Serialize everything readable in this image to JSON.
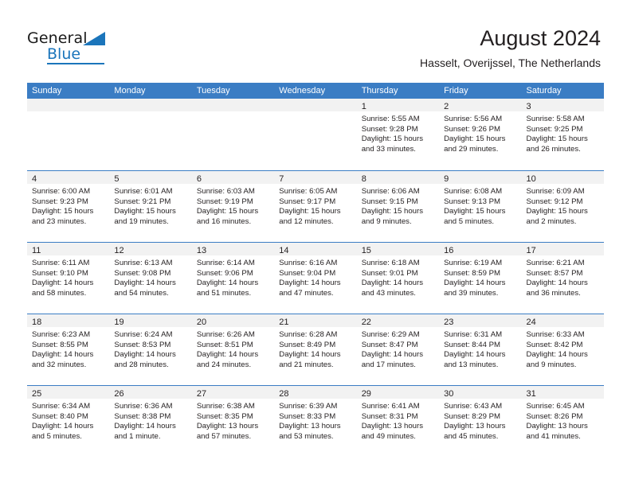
{
  "brand": {
    "name_part1": "General",
    "name_part2": "Blue",
    "accent_color": "#1b75bb"
  },
  "header": {
    "title": "August 2024",
    "subtitle": "Hasselt, Overijssel, The Netherlands"
  },
  "theme": {
    "header_blue": "#3b7dc4",
    "day_band_gray": "#f2f2f2",
    "text_color": "#231f20"
  },
  "weekdays": [
    "Sunday",
    "Monday",
    "Tuesday",
    "Wednesday",
    "Thursday",
    "Friday",
    "Saturday"
  ],
  "weeks": [
    [
      {
        "day": "",
        "lines": []
      },
      {
        "day": "",
        "lines": []
      },
      {
        "day": "",
        "lines": []
      },
      {
        "day": "",
        "lines": []
      },
      {
        "day": "1",
        "lines": [
          "Sunrise: 5:55 AM",
          "Sunset: 9:28 PM",
          "Daylight: 15 hours",
          "and 33 minutes."
        ]
      },
      {
        "day": "2",
        "lines": [
          "Sunrise: 5:56 AM",
          "Sunset: 9:26 PM",
          "Daylight: 15 hours",
          "and 29 minutes."
        ]
      },
      {
        "day": "3",
        "lines": [
          "Sunrise: 5:58 AM",
          "Sunset: 9:25 PM",
          "Daylight: 15 hours",
          "and 26 minutes."
        ]
      }
    ],
    [
      {
        "day": "4",
        "lines": [
          "Sunrise: 6:00 AM",
          "Sunset: 9:23 PM",
          "Daylight: 15 hours",
          "and 23 minutes."
        ]
      },
      {
        "day": "5",
        "lines": [
          "Sunrise: 6:01 AM",
          "Sunset: 9:21 PM",
          "Daylight: 15 hours",
          "and 19 minutes."
        ]
      },
      {
        "day": "6",
        "lines": [
          "Sunrise: 6:03 AM",
          "Sunset: 9:19 PM",
          "Daylight: 15 hours",
          "and 16 minutes."
        ]
      },
      {
        "day": "7",
        "lines": [
          "Sunrise: 6:05 AM",
          "Sunset: 9:17 PM",
          "Daylight: 15 hours",
          "and 12 minutes."
        ]
      },
      {
        "day": "8",
        "lines": [
          "Sunrise: 6:06 AM",
          "Sunset: 9:15 PM",
          "Daylight: 15 hours",
          "and 9 minutes."
        ]
      },
      {
        "day": "9",
        "lines": [
          "Sunrise: 6:08 AM",
          "Sunset: 9:13 PM",
          "Daylight: 15 hours",
          "and 5 minutes."
        ]
      },
      {
        "day": "10",
        "lines": [
          "Sunrise: 6:09 AM",
          "Sunset: 9:12 PM",
          "Daylight: 15 hours",
          "and 2 minutes."
        ]
      }
    ],
    [
      {
        "day": "11",
        "lines": [
          "Sunrise: 6:11 AM",
          "Sunset: 9:10 PM",
          "Daylight: 14 hours",
          "and 58 minutes."
        ]
      },
      {
        "day": "12",
        "lines": [
          "Sunrise: 6:13 AM",
          "Sunset: 9:08 PM",
          "Daylight: 14 hours",
          "and 54 minutes."
        ]
      },
      {
        "day": "13",
        "lines": [
          "Sunrise: 6:14 AM",
          "Sunset: 9:06 PM",
          "Daylight: 14 hours",
          "and 51 minutes."
        ]
      },
      {
        "day": "14",
        "lines": [
          "Sunrise: 6:16 AM",
          "Sunset: 9:04 PM",
          "Daylight: 14 hours",
          "and 47 minutes."
        ]
      },
      {
        "day": "15",
        "lines": [
          "Sunrise: 6:18 AM",
          "Sunset: 9:01 PM",
          "Daylight: 14 hours",
          "and 43 minutes."
        ]
      },
      {
        "day": "16",
        "lines": [
          "Sunrise: 6:19 AM",
          "Sunset: 8:59 PM",
          "Daylight: 14 hours",
          "and 39 minutes."
        ]
      },
      {
        "day": "17",
        "lines": [
          "Sunrise: 6:21 AM",
          "Sunset: 8:57 PM",
          "Daylight: 14 hours",
          "and 36 minutes."
        ]
      }
    ],
    [
      {
        "day": "18",
        "lines": [
          "Sunrise: 6:23 AM",
          "Sunset: 8:55 PM",
          "Daylight: 14 hours",
          "and 32 minutes."
        ]
      },
      {
        "day": "19",
        "lines": [
          "Sunrise: 6:24 AM",
          "Sunset: 8:53 PM",
          "Daylight: 14 hours",
          "and 28 minutes."
        ]
      },
      {
        "day": "20",
        "lines": [
          "Sunrise: 6:26 AM",
          "Sunset: 8:51 PM",
          "Daylight: 14 hours",
          "and 24 minutes."
        ]
      },
      {
        "day": "21",
        "lines": [
          "Sunrise: 6:28 AM",
          "Sunset: 8:49 PM",
          "Daylight: 14 hours",
          "and 21 minutes."
        ]
      },
      {
        "day": "22",
        "lines": [
          "Sunrise: 6:29 AM",
          "Sunset: 8:47 PM",
          "Daylight: 14 hours",
          "and 17 minutes."
        ]
      },
      {
        "day": "23",
        "lines": [
          "Sunrise: 6:31 AM",
          "Sunset: 8:44 PM",
          "Daylight: 14 hours",
          "and 13 minutes."
        ]
      },
      {
        "day": "24",
        "lines": [
          "Sunrise: 6:33 AM",
          "Sunset: 8:42 PM",
          "Daylight: 14 hours",
          "and 9 minutes."
        ]
      }
    ],
    [
      {
        "day": "25",
        "lines": [
          "Sunrise: 6:34 AM",
          "Sunset: 8:40 PM",
          "Daylight: 14 hours",
          "and 5 minutes."
        ]
      },
      {
        "day": "26",
        "lines": [
          "Sunrise: 6:36 AM",
          "Sunset: 8:38 PM",
          "Daylight: 14 hours",
          "and 1 minute."
        ]
      },
      {
        "day": "27",
        "lines": [
          "Sunrise: 6:38 AM",
          "Sunset: 8:35 PM",
          "Daylight: 13 hours",
          "and 57 minutes."
        ]
      },
      {
        "day": "28",
        "lines": [
          "Sunrise: 6:39 AM",
          "Sunset: 8:33 PM",
          "Daylight: 13 hours",
          "and 53 minutes."
        ]
      },
      {
        "day": "29",
        "lines": [
          "Sunrise: 6:41 AM",
          "Sunset: 8:31 PM",
          "Daylight: 13 hours",
          "and 49 minutes."
        ]
      },
      {
        "day": "30",
        "lines": [
          "Sunrise: 6:43 AM",
          "Sunset: 8:29 PM",
          "Daylight: 13 hours",
          "and 45 minutes."
        ]
      },
      {
        "day": "31",
        "lines": [
          "Sunrise: 6:45 AM",
          "Sunset: 8:26 PM",
          "Daylight: 13 hours",
          "and 41 minutes."
        ]
      }
    ]
  ]
}
